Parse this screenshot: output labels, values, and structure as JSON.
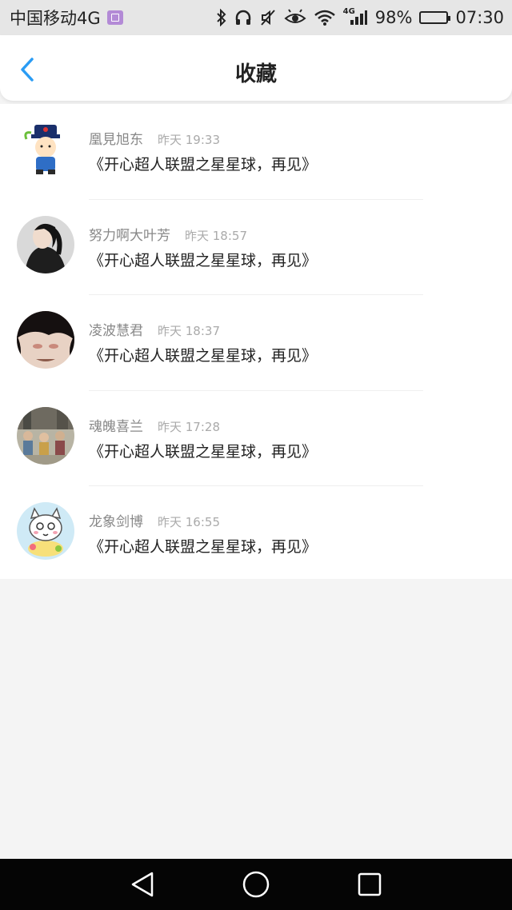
{
  "status_bar": {
    "carrier": "中国移动4G",
    "network": "4G",
    "battery": "98%",
    "battery_level": 0.98,
    "time": "07:30",
    "icons": [
      "sim-icon",
      "bluetooth-icon",
      "headphones-icon",
      "mute-icon",
      "eye-icon",
      "wifi-icon",
      "signal-icon",
      "battery-icon"
    ]
  },
  "header": {
    "title": "收藏",
    "back_icon": "chevron-left-icon",
    "accent": "#2a9cf4"
  },
  "items": [
    {
      "user": "凰見旭东",
      "time": "昨天 19:33",
      "message": "《开心超人联盟之星星球，再见》",
      "avatar": "cartoon-official-avatar"
    },
    {
      "user": "努力啊大叶芳",
      "time": "昨天 18:57",
      "message": "《开心超人联盟之星星球，再见》",
      "avatar": "woman-portrait-avatar"
    },
    {
      "user": "凌波慧君",
      "time": "昨天 18:37",
      "message": "《开心超人联盟之星星球，再见》",
      "avatar": "dark-hair-avatar"
    },
    {
      "user": "魂魄喜兰",
      "time": "昨天 17:28",
      "message": "《开心超人联盟之星星球，再见》",
      "avatar": "group-photo-avatar"
    },
    {
      "user": "龙象剑博",
      "time": "昨天 16:55",
      "message": "《开心超人联盟之星星球，再见》",
      "avatar": "cartoon-cat-avatar"
    }
  ],
  "nav": {
    "icons": [
      "back-triangle-icon",
      "home-circle-icon",
      "recents-square-icon"
    ]
  }
}
